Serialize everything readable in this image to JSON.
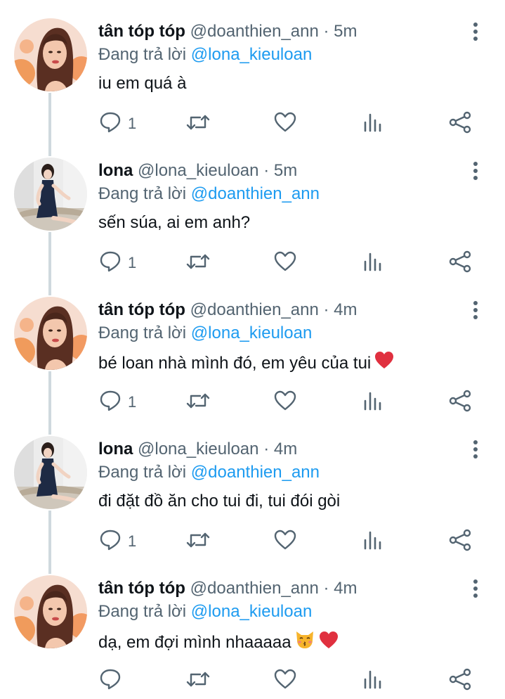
{
  "tweets": [
    {
      "name": "tân tóp tóp",
      "handle": "@doanthien_ann",
      "sep": "·",
      "time": "5m",
      "reply_prefix": "Đang trả lời",
      "reply_to": "@lona_kieuloan",
      "text": "iu em quá à",
      "emoji": [],
      "reply_count": "1",
      "avatar": "avatar-tan"
    },
    {
      "name": "lona",
      "handle": "@lona_kieuloan",
      "sep": "·",
      "time": "5m",
      "reply_prefix": "Đang trả lời",
      "reply_to": "@doanthien_ann",
      "text": "sến súa, ai em anh?",
      "emoji": [],
      "reply_count": "1",
      "avatar": "avatar-lona"
    },
    {
      "name": "tân tóp tóp",
      "handle": "@doanthien_ann",
      "sep": "·",
      "time": "4m",
      "reply_prefix": "Đang trả lời",
      "reply_to": "@lona_kieuloan",
      "text": "bé loan nhà mình đó, em yêu của tui",
      "emoji": [
        "heart-emoji"
      ],
      "reply_count": "1",
      "avatar": "avatar-tan"
    },
    {
      "name": "lona",
      "handle": "@lona_kieuloan",
      "sep": "·",
      "time": "4m",
      "reply_prefix": "Đang trả lời",
      "reply_to": "@doanthien_ann",
      "text": "đi đặt đồ ăn cho tui đi, tui đói gòi",
      "emoji": [],
      "reply_count": "1",
      "avatar": "avatar-lona"
    },
    {
      "name": "tân tóp tóp",
      "handle": "@doanthien_ann",
      "sep": "·",
      "time": "4m",
      "reply_prefix": "Đang trả lời",
      "reply_to": "@lona_kieuloan",
      "text": "dạ, em đợi mình nhaaaaa",
      "emoji": [
        "kissing-cat-emoji",
        "heart-emoji"
      ],
      "reply_count": "",
      "avatar": "avatar-tan"
    }
  ],
  "icons": {
    "reply": "reply-icon",
    "retweet": "retweet-icon",
    "like": "heart-icon",
    "stats": "analytics-icon",
    "share": "share-icon",
    "more": "more-vertical-icon"
  },
  "colors": {
    "text": "#0f1419",
    "secondary": "#536471",
    "link": "#1d9bf0",
    "thread_line": "#cfd9de",
    "heart_emoji": "#e0303f"
  }
}
